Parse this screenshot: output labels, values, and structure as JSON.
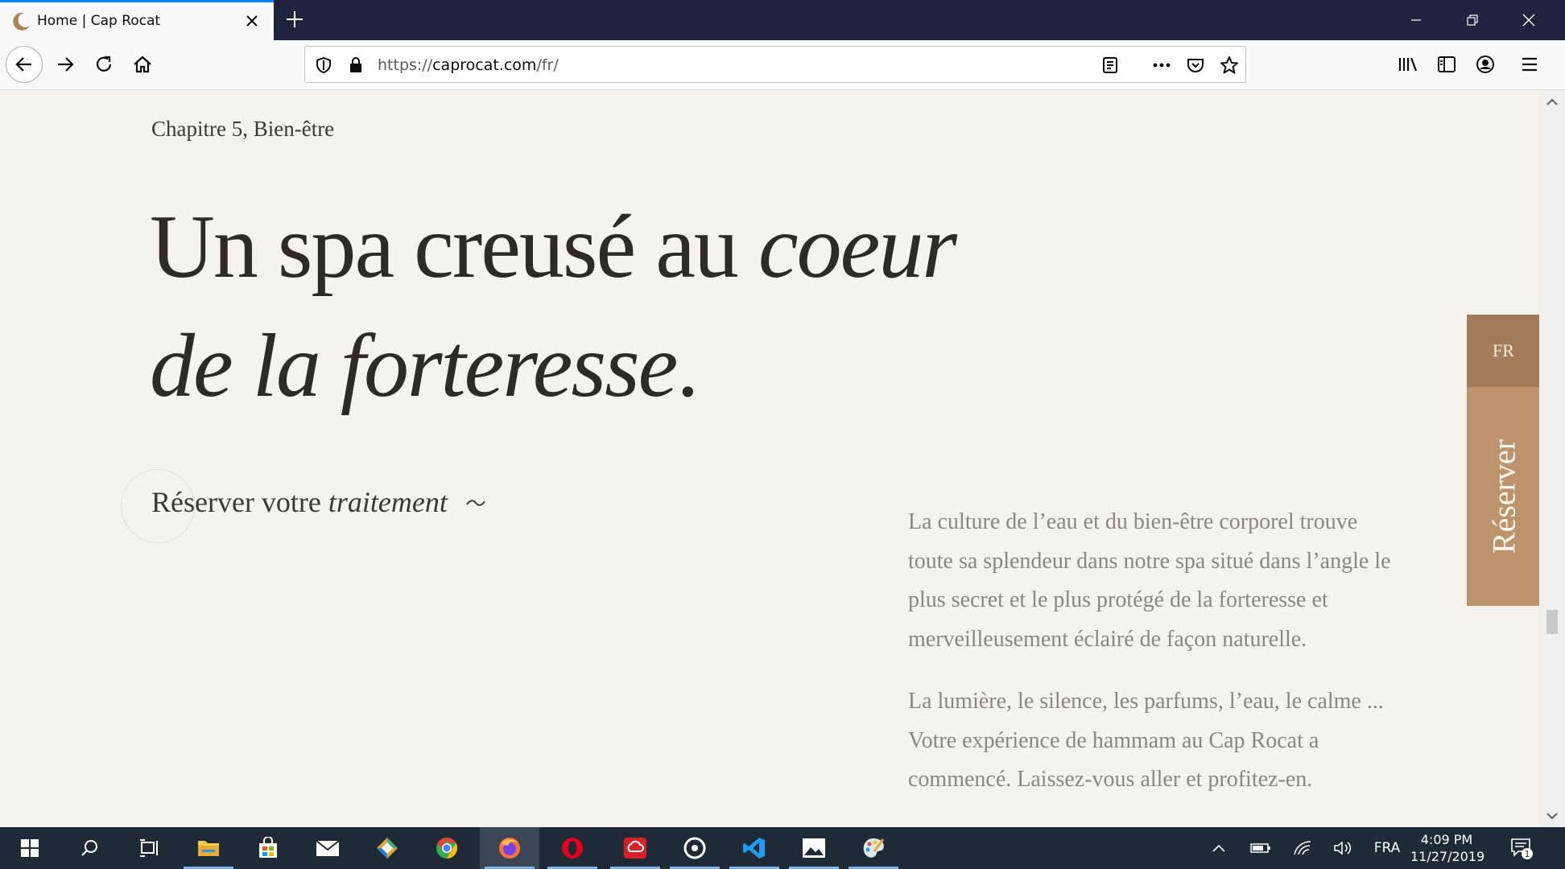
{
  "browser": {
    "tab_title": "Home | Cap Rocat",
    "url_prefix": "https://",
    "url_host": "caprocat.com",
    "url_path": "/fr/"
  },
  "page": {
    "chapter": "Chapitre 5, Bien-être",
    "headline_line1_regular": "Un spa creusé au ",
    "headline_line1_italic": "coeur",
    "headline_line2_italic": "de la forteresse",
    "headline_line2_end": ".",
    "reserve_link_regular": "Réserver votre ",
    "reserve_link_italic": "traitement",
    "paragraph1": "La culture de l’eau et du bien-être corporel trouve toute sa splendeur dans notre spa situé dans l’angle le plus secret et le plus protégé de la forteresse et merveilleusement éclairé de façon naturelle.",
    "paragraph2": "La lumière, le silence, les parfums, l’eau, le calme ... Votre expérience de hammam au Cap Rocat a commencé. Laissez-vous aller et profitez-en.",
    "side_language": "FR",
    "side_reserve": "Réserver"
  },
  "taskbar": {
    "language": "FRA",
    "time": "4:09 PM",
    "date": "11/27/2019",
    "notification_count": "1"
  },
  "colors": {
    "page_bg": "#f6f3ef",
    "side_fr_bg": "#a37c59",
    "side_reserve_bg": "#bc936d",
    "tab_accent": "#0a84ff"
  }
}
